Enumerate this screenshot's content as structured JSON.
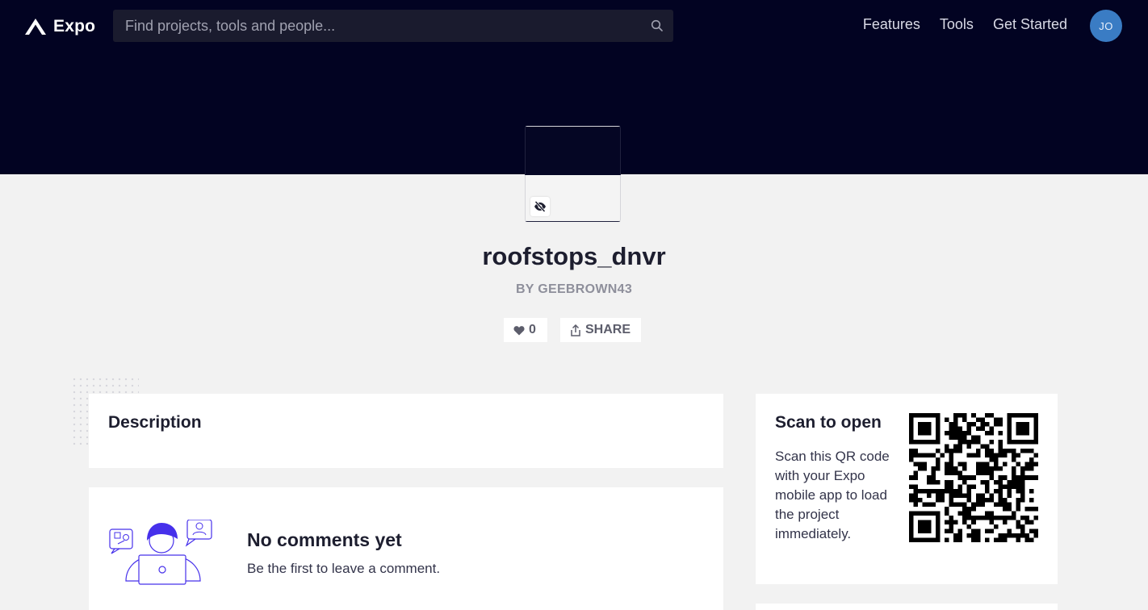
{
  "header": {
    "logo_text": "Expo",
    "search_placeholder": "Find projects, tools and people...",
    "nav": [
      {
        "label": "Features"
      },
      {
        "label": "Tools"
      },
      {
        "label": "Get Started"
      }
    ],
    "avatar_initials": "JO",
    "background_color": "#020322"
  },
  "project": {
    "title": "roofstops_dnvr",
    "byline": "BY GEEBROWN43",
    "likes": "0",
    "share_label": "SHARE",
    "visibility_icon": "eye-slash-icon"
  },
  "description": {
    "title": "Description"
  },
  "comments": {
    "title": "No comments yet",
    "subtitle": "Be the first to leave a comment."
  },
  "qr": {
    "title": "Scan to open",
    "text": "Scan this QR code with your Expo mobile app to load the project immediately."
  },
  "colors": {
    "accent": "#3a7cc4",
    "illustration": "#4630eb",
    "page_background": "#f2f2f2"
  }
}
